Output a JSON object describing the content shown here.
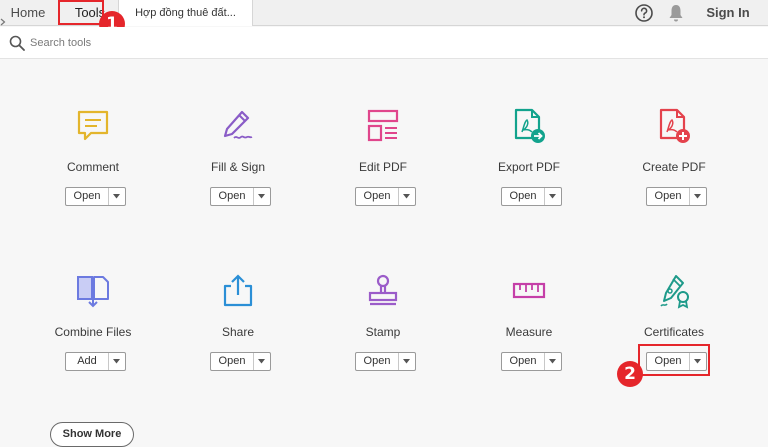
{
  "tabs": {
    "home": "Home",
    "tools": "Tools",
    "document": "Hợp đồng thuê đất..."
  },
  "header": {
    "sign_in": "Sign In"
  },
  "search": {
    "placeholder": "Search tools"
  },
  "callouts": {
    "first": "1",
    "second": "2"
  },
  "tools": [
    {
      "label": "Comment",
      "button": "Open"
    },
    {
      "label": "Fill & Sign",
      "button": "Open"
    },
    {
      "label": "Edit PDF",
      "button": "Open"
    },
    {
      "label": "Export PDF",
      "button": "Open"
    },
    {
      "label": "Create PDF",
      "button": "Open"
    },
    {
      "label": "Combine Files",
      "button": "Add"
    },
    {
      "label": "Share",
      "button": "Open"
    },
    {
      "label": "Stamp",
      "button": "Open"
    },
    {
      "label": "Measure",
      "button": "Open"
    },
    {
      "label": "Certificates",
      "button": "Open"
    }
  ],
  "show_more": "Show More",
  "icons": [
    "comment-icon",
    "fill-sign-icon",
    "edit-pdf-icon",
    "export-pdf-icon",
    "create-pdf-icon",
    "combine-files-icon",
    "share-icon",
    "stamp-icon",
    "measure-icon",
    "certificates-icon"
  ],
  "colors": {
    "highlight": "#e5262b",
    "comment": "#e3b52c",
    "fill_sign": "#8a5cc7",
    "edit_pdf": "#e0468c",
    "export_pdf": "#12a38d",
    "create_pdf": "#e4424c",
    "combine": "#6c7ae0",
    "share": "#2b8fd6",
    "stamp": "#9b5cc9",
    "measure": "#c53fa8",
    "certificates": "#1e9a8a"
  }
}
